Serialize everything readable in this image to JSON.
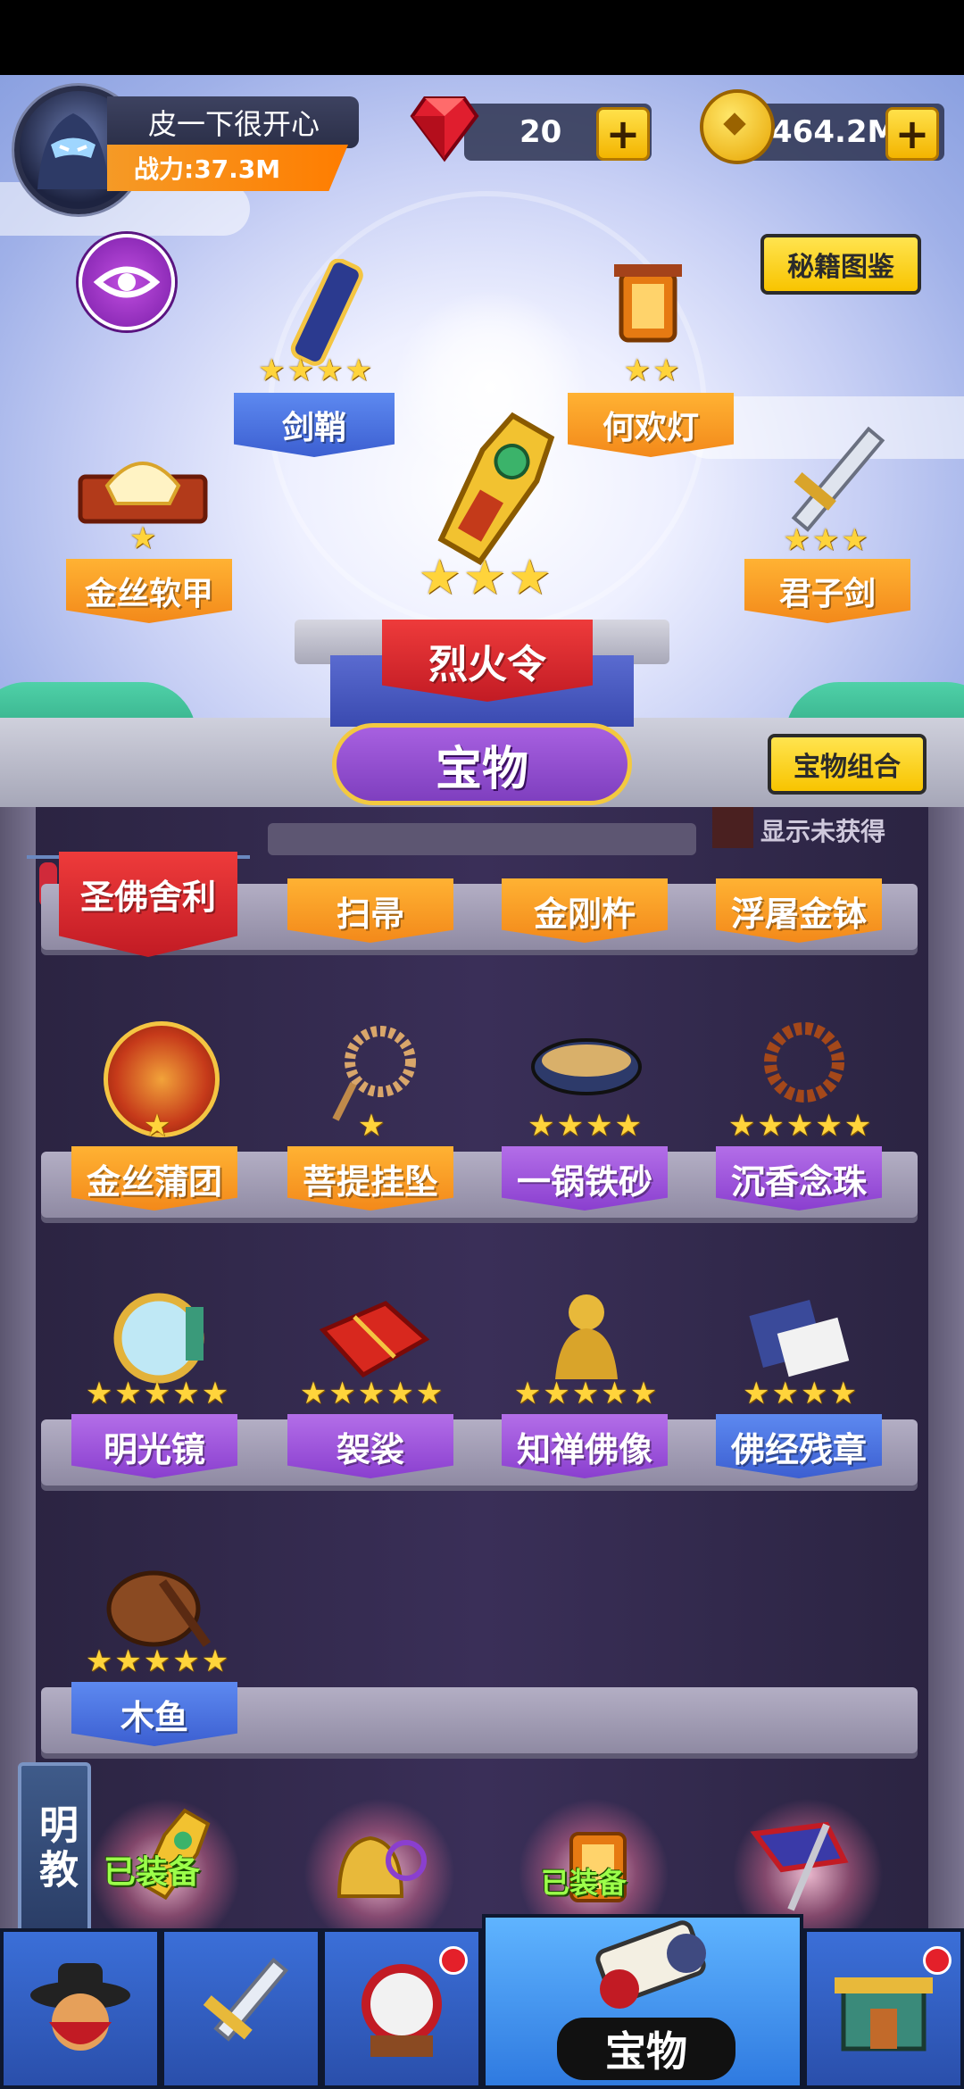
{
  "header": {
    "player_name": "皮一下很开心",
    "power_label": "战力:37.3M",
    "gems": "20",
    "coins": "464.2M",
    "add_symbol": "+"
  },
  "buttons": {
    "codex": "秘籍图鉴",
    "combo": "宝物组合",
    "show_unobtained": "显示未获得"
  },
  "equipped": {
    "center": {
      "name": "烈火令",
      "stars": 3
    },
    "slots": [
      {
        "name": "剑鞘",
        "stars": 4,
        "color": "blue"
      },
      {
        "name": "何欢灯",
        "stars": 2,
        "color": "orange"
      },
      {
        "name": "金丝软甲",
        "stars": 1,
        "color": "orange"
      },
      {
        "name": "君子剑",
        "stars": 3,
        "color": "orange"
      }
    ]
  },
  "section_title": "宝物",
  "faction_tag": "明教",
  "equipped_badge": "已装备",
  "shelves": [
    {
      "items": [
        {
          "name": "圣佛舍利",
          "color": "red",
          "stars": 0
        },
        {
          "name": "扫帚",
          "color": "orange",
          "stars": 0
        },
        {
          "name": "金刚杵",
          "color": "orange",
          "stars": 0
        },
        {
          "name": "浮屠金钵",
          "color": "orange",
          "stars": 0
        }
      ]
    },
    {
      "items": [
        {
          "name": "金丝蒲团",
          "color": "orange",
          "stars": 1
        },
        {
          "name": "菩提挂坠",
          "color": "orange",
          "stars": 1
        },
        {
          "name": "一锅铁砂",
          "color": "purple",
          "stars": 4
        },
        {
          "name": "沉香念珠",
          "color": "purple",
          "stars": 5
        }
      ]
    },
    {
      "items": [
        {
          "name": "明光镜",
          "color": "purple",
          "stars": 5
        },
        {
          "name": "袈裟",
          "color": "purple",
          "stars": 5
        },
        {
          "name": "知禅佛像",
          "color": "purple",
          "stars": 5
        },
        {
          "name": "佛经残章",
          "color": "blue",
          "stars": 4
        }
      ]
    },
    {
      "items": [
        {
          "name": "木鱼",
          "color": "blue",
          "stars": 5
        }
      ]
    }
  ],
  "nav": {
    "tabs": [
      "hero",
      "weapon",
      "drum",
      "treasure",
      "shop"
    ],
    "active_label": "宝物"
  },
  "colors": {
    "orange": "#f3891a",
    "blue": "#3c5fd1",
    "purple": "#8a3fcf",
    "red": "#c21b24",
    "star": "#ffd43b"
  }
}
